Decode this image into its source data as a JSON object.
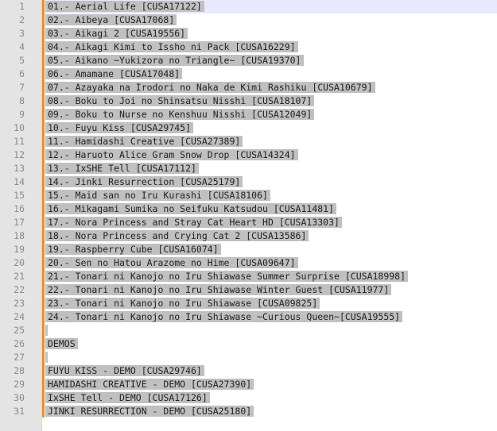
{
  "editor": {
    "lines": [
      {
        "n": "1",
        "text": "01.- Aerial Life [CUSA17122]"
      },
      {
        "n": "2",
        "text": "02.- Aibeya [CUSA17068]"
      },
      {
        "n": "3",
        "text": "03.- Aikagi 2 [CUSA19556]"
      },
      {
        "n": "4",
        "text": "04.- Aikagi Kimi to Issho ni Pack [CUSA16229]"
      },
      {
        "n": "5",
        "text": "05.- Aikano ~Yukizora no Triangle~ [CUSA19370]"
      },
      {
        "n": "6",
        "text": "06.- Amamane [CUSA17048]"
      },
      {
        "n": "7",
        "text": "07.- Azayaka na Irodori no Naka de Kimi Rashiku [CUSA10679]"
      },
      {
        "n": "8",
        "text": "08.- Boku to Joi no Shinsatsu Nisshi [CUSA18107]"
      },
      {
        "n": "9",
        "text": "09.- Boku to Nurse no Kenshuu Nisshi [CUSA12049]"
      },
      {
        "n": "10",
        "text": "10.- Fuyu Kiss [CUSA29745]"
      },
      {
        "n": "11",
        "text": "11.- Hamidashi Creative [CUSA27389]"
      },
      {
        "n": "12",
        "text": "12.- Haruoto Alice Gram Snow Drop [CUSA14324]"
      },
      {
        "n": "13",
        "text": "13.- IxSHE Tell [CUSA17112]"
      },
      {
        "n": "14",
        "text": "14.- Jinki Resurrection [CUSA25179]"
      },
      {
        "n": "15",
        "text": "15.- Maid san no Iru Kurashi [CUSA18106]"
      },
      {
        "n": "16",
        "text": "16.- Mikagami Sumika no Seifuku Katsudou [CUSA11481]"
      },
      {
        "n": "17",
        "text": "17.- Nora Princess and Stray Cat Heart HD [CUSA13303]"
      },
      {
        "n": "18",
        "text": "18.- Nora Princess and Crying Cat 2 [CUSA13586]"
      },
      {
        "n": "19",
        "text": "19.- Raspberry Cube [CUSA16074]"
      },
      {
        "n": "20",
        "text": "20.- Sen no Hatou Arazome no Hime [CUSA09647]"
      },
      {
        "n": "21",
        "text": "21.- Tonari ni Kanojo no Iru Shiawase Summer Surprise [CUSA18998]"
      },
      {
        "n": "22",
        "text": "22.- Tonari ni Kanojo no Iru Shiawase Winter Guest [CUSA11977]"
      },
      {
        "n": "23",
        "text": "23.- Tonari ni Kanojo no Iru Shiawase [CUSA09825]"
      },
      {
        "n": "24",
        "text": "24.- Tonari ni Kanojo no Iru Shiawase ~Curious Queen~[CUSA19555]"
      },
      {
        "n": "25",
        "text": ""
      },
      {
        "n": "26",
        "text": "DEMOS"
      },
      {
        "n": "27",
        "text": ""
      },
      {
        "n": "28",
        "text": "FUYU KISS - DEMO [CUSA29746]"
      },
      {
        "n": "29",
        "text": "HAMIDASHI CREATIVE - DEMO [CUSA27390]"
      },
      {
        "n": "30",
        "text": "IxSHE Tell - DEMO [CUSA17126]"
      },
      {
        "n": "31",
        "text": "JINKI RESURRECTION - DEMO [CUSA25180]"
      }
    ]
  },
  "colors": {
    "gutter_bg": "#e4e4e4",
    "change_bar": "#f28c1e",
    "selection": "#c0c0c0",
    "current_line": "#e8e8ff"
  }
}
